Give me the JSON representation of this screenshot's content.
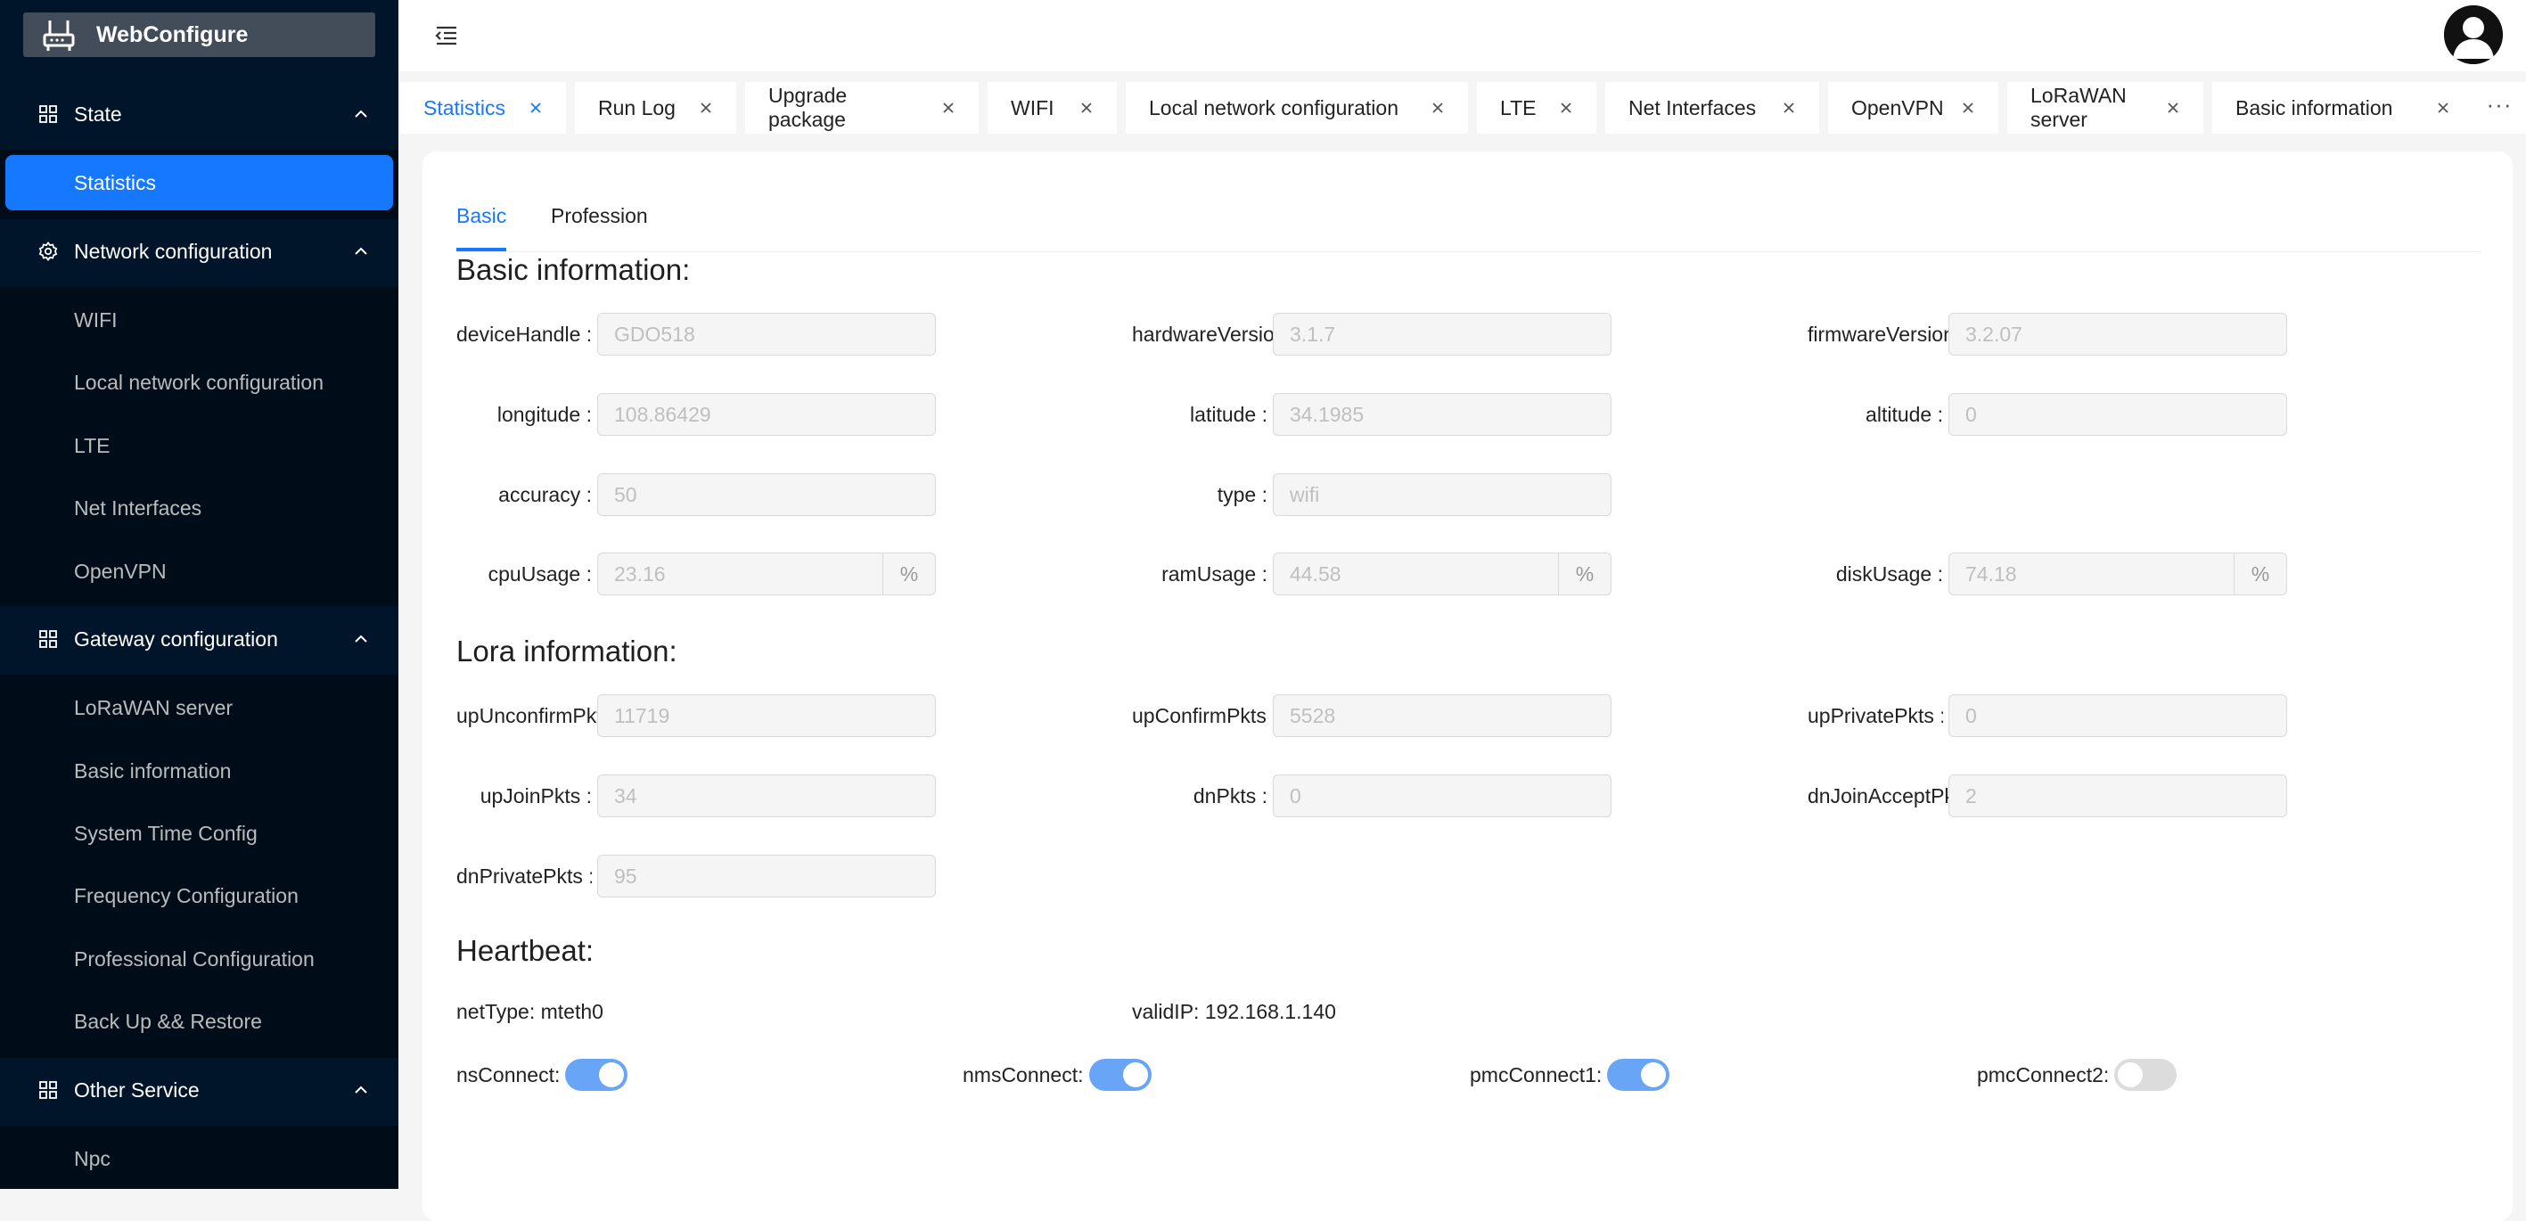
{
  "app": {
    "title": "WebConfigure"
  },
  "sidebar": {
    "groups": [
      {
        "label": "State",
        "icon": "grid-icon",
        "items": [
          "Statistics"
        ]
      },
      {
        "label": "Network configuration",
        "icon": "gear-icon",
        "items": [
          "WIFI",
          "Local network configuration",
          "LTE",
          "Net Interfaces",
          "OpenVPN"
        ]
      },
      {
        "label": "Gateway configuration",
        "icon": "grid-icon",
        "items": [
          "LoRaWAN server",
          "Basic information",
          "System Time Config",
          "Frequency Configuration",
          "Professional Configuration",
          "Back Up && Restore"
        ]
      },
      {
        "label": "Other Service",
        "icon": "grid-icon",
        "items": [
          "Npc"
        ]
      }
    ],
    "active_item": "Statistics"
  },
  "tabs": [
    "Statistics",
    "Run Log",
    "Upgrade package",
    "WIFI",
    "Local network configuration",
    "LTE",
    "Net Interfaces",
    "OpenVPN",
    "LoRaWAN server",
    "Basic information"
  ],
  "tabs_more": "···",
  "subtabs": [
    "Basic",
    "Profession"
  ],
  "basic": {
    "title": "Basic information:",
    "deviceHandle": {
      "label": "deviceHandle",
      "value": "GDO518"
    },
    "hardwareVersion": {
      "label": "hardwareVersion",
      "value": "3.1.7"
    },
    "firmwareVersion": {
      "label": "firmwareVersion",
      "value": "3.2.07"
    },
    "longitude": {
      "label": "longitude",
      "value": "108.86429"
    },
    "latitude": {
      "label": "latitude",
      "value": "34.1985"
    },
    "altitude": {
      "label": "altitude",
      "value": "0"
    },
    "accuracy": {
      "label": "accuracy",
      "value": "50"
    },
    "type": {
      "label": "type",
      "value": "wifi"
    },
    "cpuUsage": {
      "label": "cpuUsage",
      "value": "23.16",
      "unit": "%"
    },
    "ramUsage": {
      "label": "ramUsage",
      "value": "44.58",
      "unit": "%"
    },
    "diskUsage": {
      "label": "diskUsage",
      "value": "74.18",
      "unit": "%"
    }
  },
  "lora": {
    "title": "Lora information:",
    "upUnconfirmPkts": {
      "label": "upUnconfirmPkts",
      "value": "11719"
    },
    "upConfirmPkts": {
      "label": "upConfirmPkts",
      "value": "5528"
    },
    "upPrivatePkts": {
      "label": "upPrivatePkts",
      "value": "0"
    },
    "upJoinPkts": {
      "label": "upJoinPkts",
      "value": "34"
    },
    "dnPkts": {
      "label": "dnPkts",
      "value": "0"
    },
    "dnJoinAcceptPkts": {
      "label": "dnJoinAcceptPkts",
      "value": "2"
    },
    "dnPrivatePkts": {
      "label": "dnPrivatePkts",
      "value": "95"
    }
  },
  "heartbeat": {
    "title": "Heartbeat:",
    "netType": "netType: mteth0",
    "validIP": "validIP: 192.168.1.140",
    "nsConnect": {
      "label": "nsConnect:",
      "on": true
    },
    "nmsConnect": {
      "label": "nmsConnect:",
      "on": true
    },
    "pmcConnect1": {
      "label": "pmcConnect1:",
      "on": true
    },
    "pmcConnect2": {
      "label": "pmcConnect2:",
      "on": false
    }
  },
  "colors": {
    "sidebar_bg": "#001529",
    "primary": "#1677ff",
    "switch_on": "#69a5f7"
  }
}
